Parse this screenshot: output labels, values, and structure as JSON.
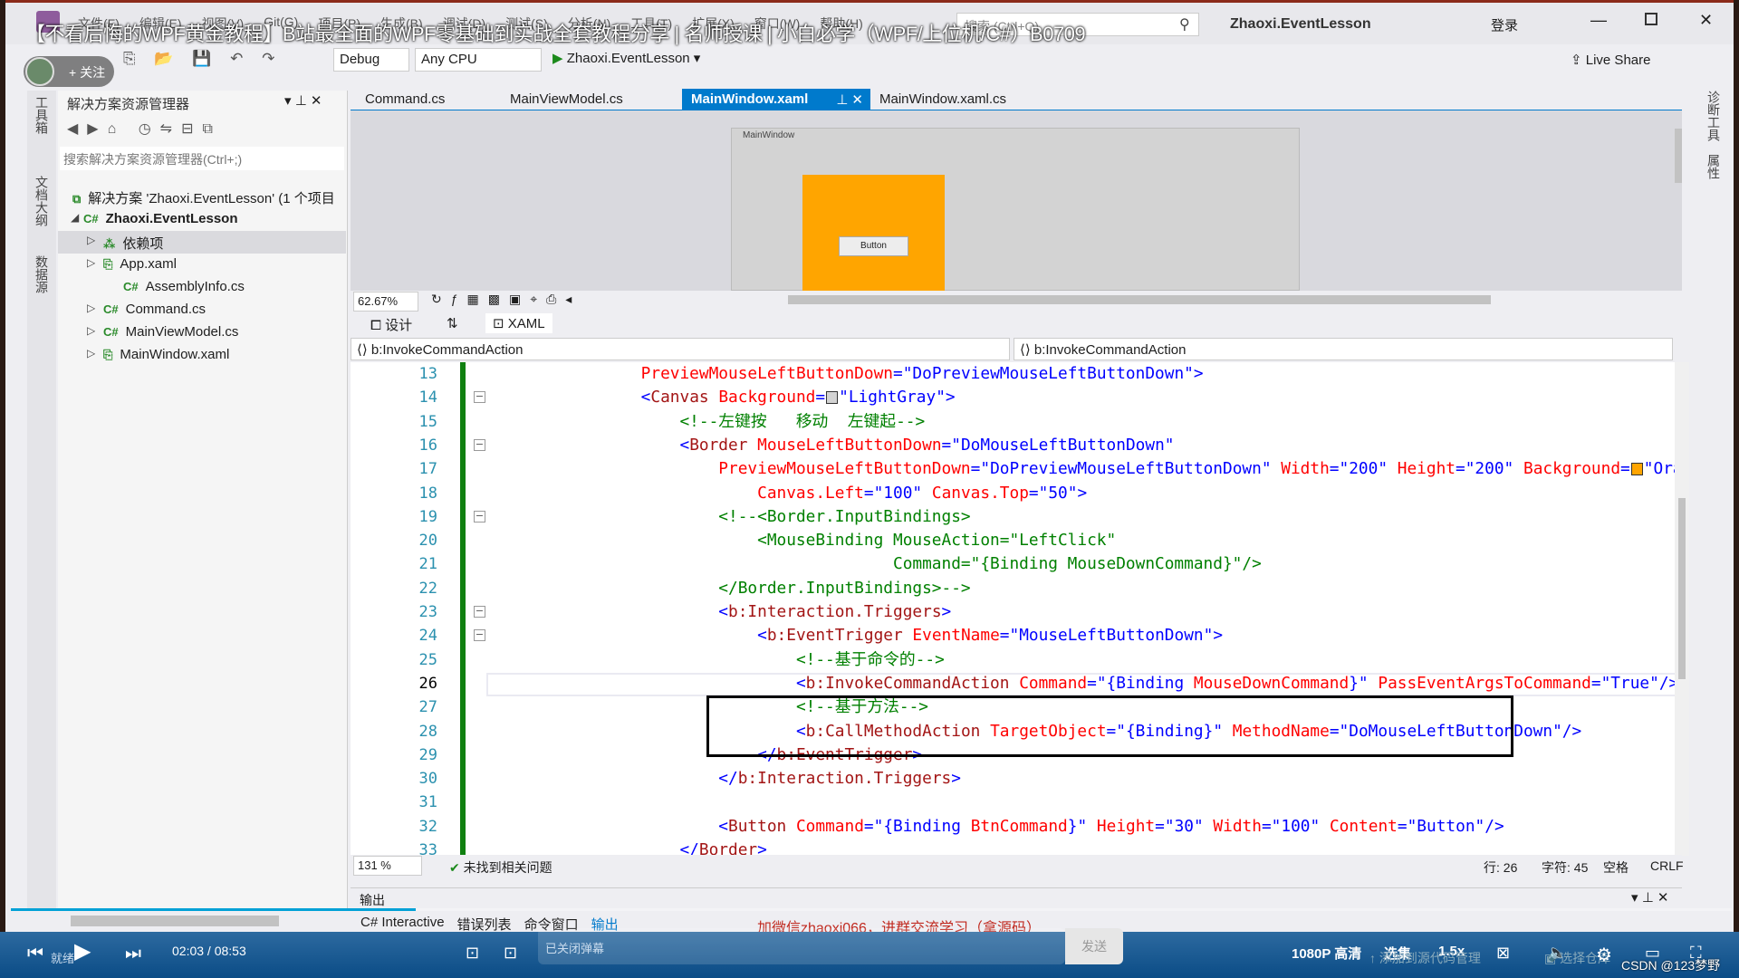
{
  "overlay": {
    "video_title": "【不看后悔的WPF黄金教程】B站最全面的WPF零基础到实战全套教程分享 | 名师授课 | 小白必学（WPF/上位机/C#）B0709",
    "follow_label": "+ 关注",
    "promo_text": "加微信zhaoxi066，进群交流学习（拿源码）",
    "watermark": "CSDN @123梦野"
  },
  "titlebar": {
    "menu": [
      "文件(F)",
      "编辑(E)",
      "视图(V)",
      "Git(G)",
      "项目(P)",
      "生成(B)",
      "调试(D)",
      "测试(S)",
      "分析(N)",
      "工具(T)",
      "扩展(X)",
      "窗口(W)",
      "帮助(H)"
    ],
    "search_placeholder": "搜索 (Ctrl+Q)",
    "project": "Zhaoxi.EventLesson",
    "login": "登录"
  },
  "toolbar": {
    "config": "Debug",
    "platform": "Any CPU",
    "run_target": "Zhaoxi.EventLesson",
    "live_share": "Live Share"
  },
  "solution_explorer": {
    "title": "解决方案资源管理器",
    "search_placeholder": "搜索解决方案资源管理器(Ctrl+;)",
    "items": [
      {
        "label": "解决方案 'Zhaoxi.EventLesson' (1 个项目",
        "icon": "solution-icon"
      },
      {
        "label": "Zhaoxi.EventLesson",
        "icon": "csharp-project-icon"
      },
      {
        "label": "依赖项",
        "icon": "dependencies-icon"
      },
      {
        "label": "App.xaml",
        "icon": "xaml-file-icon"
      },
      {
        "label": "AssemblyInfo.cs",
        "icon": "csharp-file-icon"
      },
      {
        "label": "Command.cs",
        "icon": "csharp-file-icon"
      },
      {
        "label": "MainViewModel.cs",
        "icon": "csharp-file-icon"
      },
      {
        "label": "MainWindow.xaml",
        "icon": "xaml-file-icon"
      }
    ]
  },
  "left_vertical_tabs": [
    "工具箱",
    "文档大纲",
    "数据源"
  ],
  "right_vertical_tabs": [
    "诊断工具",
    "属性"
  ],
  "doc_tabs": [
    {
      "label": "Command.cs"
    },
    {
      "label": "MainViewModel.cs"
    },
    {
      "label": "MainWindow.xaml",
      "active": true
    },
    {
      "label": "MainWindow.xaml.cs"
    }
  ],
  "designer": {
    "window_title": "MainWindow",
    "button_label": "Button",
    "zoom": "62.67%",
    "border_color": "#FFA500",
    "canvas_color": "#D3D3D3"
  },
  "view_tabs": {
    "design": "设计",
    "xaml": "XAML"
  },
  "nav": {
    "left": "b:InvokeCommandAction",
    "right": "b:InvokeCommandAction"
  },
  "code": {
    "lines": [
      {
        "n": "13",
        "tokens": [
          [
            "t",
            "        "
          ],
          [
            "attr",
            "PreviewMouseLeftButtonDown"
          ],
          [
            "punc",
            "=\""
          ],
          [
            "val",
            "DoPreviewMouseLeftButtonDown"
          ],
          [
            "punc",
            "\">"
          ]
        ]
      },
      {
        "n": "14",
        "tokens": [
          [
            "t",
            "        "
          ],
          [
            "punc",
            "<"
          ],
          [
            "tag",
            "Canvas"
          ],
          [
            "t",
            " "
          ],
          [
            "attr",
            "Background"
          ],
          [
            "punc",
            "="
          ],
          [
            "sw",
            "#D3D3D3"
          ],
          [
            "punc",
            "\""
          ],
          [
            "val",
            "LightGray"
          ],
          [
            "punc",
            "\">"
          ]
        ]
      },
      {
        "n": "15",
        "tokens": [
          [
            "t",
            "            "
          ],
          [
            "com",
            "<!--左键按   移动  左键起-->"
          ]
        ]
      },
      {
        "n": "16",
        "tokens": [
          [
            "t",
            "            "
          ],
          [
            "punc",
            "<"
          ],
          [
            "tag",
            "Border"
          ],
          [
            "t",
            " "
          ],
          [
            "attr",
            "MouseLeftButtonDown"
          ],
          [
            "punc",
            "=\""
          ],
          [
            "val",
            "DoMouseLeftButtonDown"
          ],
          [
            "punc",
            "\""
          ]
        ]
      },
      {
        "n": "17",
        "tokens": [
          [
            "t",
            "                "
          ],
          [
            "attr",
            "PreviewMouseLeftButtonDown"
          ],
          [
            "punc",
            "=\""
          ],
          [
            "val",
            "DoPreviewMouseLeftButtonDown"
          ],
          [
            "punc",
            "\""
          ],
          [
            "t",
            " "
          ],
          [
            "attr",
            "Width"
          ],
          [
            "punc",
            "=\""
          ],
          [
            "val",
            "200"
          ],
          [
            "punc",
            "\""
          ],
          [
            "t",
            " "
          ],
          [
            "attr",
            "Height"
          ],
          [
            "punc",
            "=\""
          ],
          [
            "val",
            "200"
          ],
          [
            "punc",
            "\""
          ],
          [
            "t",
            " "
          ],
          [
            "attr",
            "Background"
          ],
          [
            "punc",
            "="
          ],
          [
            "sw",
            "#FFA500"
          ],
          [
            "punc",
            "\""
          ],
          [
            "val",
            "Orange"
          ],
          [
            "punc",
            "\""
          ]
        ]
      },
      {
        "n": "18",
        "tokens": [
          [
            "t",
            "                    "
          ],
          [
            "attr",
            "Canvas.Left"
          ],
          [
            "punc",
            "=\""
          ],
          [
            "val",
            "100"
          ],
          [
            "punc",
            "\""
          ],
          [
            "t",
            " "
          ],
          [
            "attr",
            "Canvas.Top"
          ],
          [
            "punc",
            "=\""
          ],
          [
            "val",
            "50"
          ],
          [
            "punc",
            "\">"
          ]
        ]
      },
      {
        "n": "19",
        "tokens": [
          [
            "t",
            "                "
          ],
          [
            "com",
            "<!--<Border.InputBindings>"
          ]
        ]
      },
      {
        "n": "20",
        "tokens": [
          [
            "t",
            "                    "
          ],
          [
            "com",
            "<MouseBinding MouseAction=\"LeftClick\""
          ]
        ]
      },
      {
        "n": "21",
        "tokens": [
          [
            "t",
            "                                  "
          ],
          [
            "com",
            "Command=\"{Binding MouseDownCommand}\"/>"
          ]
        ]
      },
      {
        "n": "22",
        "tokens": [
          [
            "t",
            "                "
          ],
          [
            "com",
            "</Border.InputBindings>-->"
          ]
        ]
      },
      {
        "n": "23",
        "tokens": [
          [
            "t",
            "                "
          ],
          [
            "punc",
            "<"
          ],
          [
            "tag",
            "b:Interaction.Triggers"
          ],
          [
            "punc",
            ">"
          ]
        ]
      },
      {
        "n": "24",
        "tokens": [
          [
            "t",
            "                    "
          ],
          [
            "punc",
            "<"
          ],
          [
            "tag",
            "b:EventTrigger"
          ],
          [
            "t",
            " "
          ],
          [
            "attr",
            "EventName"
          ],
          [
            "punc",
            "=\""
          ],
          [
            "val",
            "MouseLeftButtonDown"
          ],
          [
            "punc",
            "\">"
          ]
        ]
      },
      {
        "n": "25",
        "tokens": [
          [
            "t",
            "                        "
          ],
          [
            "com",
            "<!--基于命令的-->"
          ]
        ]
      },
      {
        "n": "26",
        "tokens": [
          [
            "t",
            "                        "
          ],
          [
            "punc",
            "<"
          ],
          [
            "tag",
            "b:InvokeCommandAction"
          ],
          [
            "t",
            " "
          ],
          [
            "attr",
            "Command"
          ],
          [
            "punc",
            "=\""
          ],
          [
            "val",
            "{Binding "
          ],
          [
            "attr",
            "MouseDownCommand"
          ],
          [
            "val",
            "}"
          ],
          [
            "punc",
            "\""
          ],
          [
            "t",
            " "
          ],
          [
            "attr",
            "PassEventArgsToCommand"
          ],
          [
            "punc",
            "=\""
          ],
          [
            "val",
            "True"
          ],
          [
            "punc",
            "\"/>"
          ]
        ]
      },
      {
        "n": "27",
        "tokens": [
          [
            "t",
            "                        "
          ],
          [
            "com",
            "<!--基于方法-->"
          ]
        ]
      },
      {
        "n": "28",
        "tokens": [
          [
            "t",
            "                        "
          ],
          [
            "punc",
            "<"
          ],
          [
            "tag",
            "b:CallMethodAction"
          ],
          [
            "t",
            " "
          ],
          [
            "attr",
            "TargetObject"
          ],
          [
            "punc",
            "=\""
          ],
          [
            "val",
            "{Binding}"
          ],
          [
            "punc",
            "\""
          ],
          [
            "t",
            " "
          ],
          [
            "attr",
            "MethodName"
          ],
          [
            "punc",
            "=\""
          ],
          [
            "val",
            "DoMouseLeftButtonDown"
          ],
          [
            "punc",
            "\"/>"
          ]
        ]
      },
      {
        "n": "29",
        "tokens": [
          [
            "t",
            "                    "
          ],
          [
            "punc",
            "</"
          ],
          [
            "tag",
            "b:EventTrigger"
          ],
          [
            "punc",
            ">"
          ]
        ]
      },
      {
        "n": "30",
        "tokens": [
          [
            "t",
            "                "
          ],
          [
            "punc",
            "</"
          ],
          [
            "tag",
            "b:Interaction.Triggers"
          ],
          [
            "punc",
            ">"
          ]
        ]
      },
      {
        "n": "31",
        "tokens": []
      },
      {
        "n": "32",
        "tokens": [
          [
            "t",
            "                "
          ],
          [
            "punc",
            "<"
          ],
          [
            "tag",
            "Button"
          ],
          [
            "t",
            " "
          ],
          [
            "attr",
            "Command"
          ],
          [
            "punc",
            "=\""
          ],
          [
            "val",
            "{Binding "
          ],
          [
            "attr",
            "BtnCommand"
          ],
          [
            "val",
            "}"
          ],
          [
            "punc",
            "\""
          ],
          [
            "t",
            " "
          ],
          [
            "attr",
            "Height"
          ],
          [
            "punc",
            "=\""
          ],
          [
            "val",
            "30"
          ],
          [
            "punc",
            "\""
          ],
          [
            "t",
            " "
          ],
          [
            "attr",
            "Width"
          ],
          [
            "punc",
            "=\""
          ],
          [
            "val",
            "100"
          ],
          [
            "punc",
            "\""
          ],
          [
            "t",
            " "
          ],
          [
            "attr",
            "Content"
          ],
          [
            "punc",
            "=\""
          ],
          [
            "val",
            "Button"
          ],
          [
            "punc",
            "\"/>"
          ]
        ]
      },
      {
        "n": "33",
        "tokens": [
          [
            "t",
            "            "
          ],
          [
            "punc",
            "</"
          ],
          [
            "tag",
            "Border"
          ],
          [
            "punc",
            ">"
          ]
        ]
      }
    ]
  },
  "editor_status": {
    "zoom": "131 %",
    "issues": "未找到相关问题",
    "line": "行: 26",
    "char": "字符: 45",
    "spaces": "空格",
    "eol": "CRLF"
  },
  "output": {
    "title": "输出",
    "tabs": [
      "C# Interactive",
      "错误列表",
      "命令窗口",
      "输出"
    ]
  },
  "statusbar": {
    "ready": "就绪",
    "add_source": "添加到源代码管理",
    "select_repo": "选择仓库"
  },
  "player": {
    "time": "02:03 / 08:53",
    "danmaku_placeholder": "已关闭弹幕",
    "send": "发送",
    "quality": "1080P 高清",
    "episodes": "选集",
    "speed": "1.5x",
    "progress_percent": 23.5,
    "accent": "#00a1d6"
  }
}
